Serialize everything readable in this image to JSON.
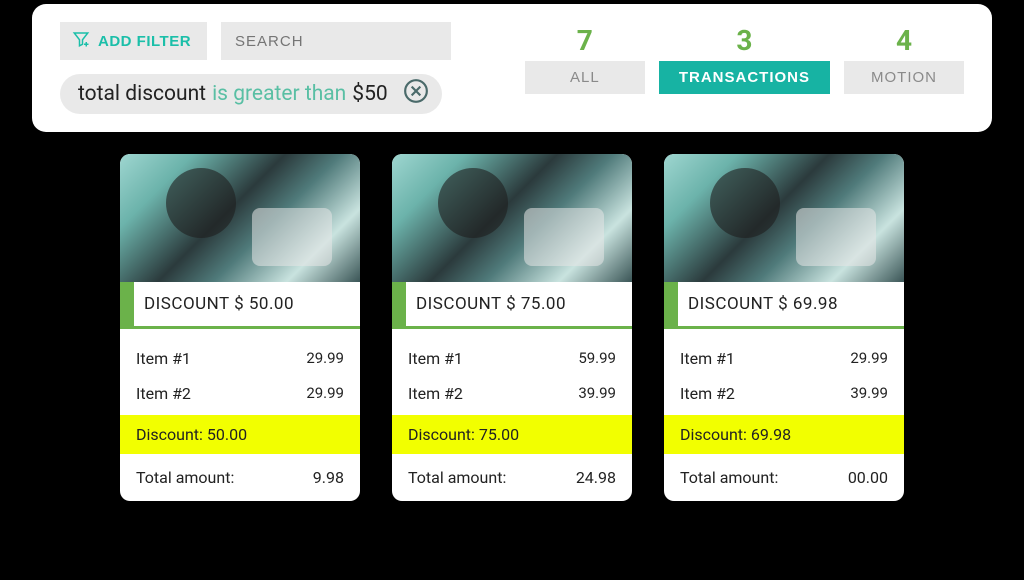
{
  "filterBar": {
    "addFilterLabel": "ADD FILTER",
    "searchPlaceholder": "SEARCH",
    "chip": {
      "field": "total discount",
      "operator": "is greater than",
      "value": "$50"
    },
    "tabs": [
      {
        "count": "7",
        "label": "ALL",
        "active": false
      },
      {
        "count": "3",
        "label": "TRANSACTIONS",
        "active": true
      },
      {
        "count": "4",
        "label": "MOTION",
        "active": false
      }
    ]
  },
  "cards": [
    {
      "discountTitle": "DISCOUNT $ 50.00",
      "items": [
        {
          "name": "Item #1",
          "price": "29.99"
        },
        {
          "name": "Item #2",
          "price": "29.99"
        }
      ],
      "discountLine": "Discount: 50.00",
      "totalLabel": "Total amount:",
      "totalValue": "9.98"
    },
    {
      "discountTitle": "DISCOUNT $ 75.00",
      "items": [
        {
          "name": "Item #1",
          "price": "59.99"
        },
        {
          "name": "Item #2",
          "price": "39.99"
        }
      ],
      "discountLine": "Discount: 75.00",
      "totalLabel": "Total amount:",
      "totalValue": "24.98"
    },
    {
      "discountTitle": "DISCOUNT $ 69.98",
      "items": [
        {
          "name": "Item #1",
          "price": "29.99"
        },
        {
          "name": "Item #2",
          "price": "39.99"
        }
      ],
      "discountLine": "Discount: 69.98",
      "totalLabel": "Total amount:",
      "totalValue": "00.00"
    }
  ]
}
